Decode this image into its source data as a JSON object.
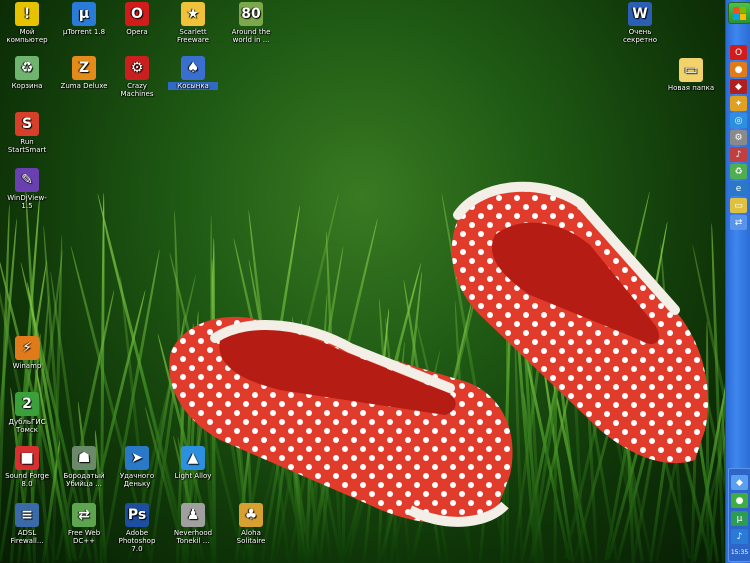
{
  "desktop": {
    "icons": [
      {
        "label": "Мой компьютер",
        "icon": "my-computer-warning-icon"
      },
      {
        "label": "µTorrent 1.8",
        "icon": "utorrent-icon"
      },
      {
        "label": "Opera",
        "icon": "opera-icon"
      },
      {
        "label": "Scarlett Freeware",
        "icon": "scarlett-icon"
      },
      {
        "label": "Around the world in ...",
        "icon": "around-world-game-icon"
      },
      {
        "label": "Очень секретно",
        "icon": "word-document-icon"
      },
      {
        "label": "Корзина",
        "icon": "recycle-bin-icon"
      },
      {
        "label": "Zuma Deluxe",
        "icon": "zuma-deluxe-icon"
      },
      {
        "label": "Crazy Machines",
        "icon": "crazy-machines-icon"
      },
      {
        "label": "Косынка",
        "icon": "solitaire-shortcut-icon"
      },
      {
        "label": "Новая папка",
        "icon": "folder-icon"
      },
      {
        "label": "Run StartSmart",
        "icon": "startsmart-icon"
      },
      {
        "label": "WinDjView-1.5",
        "icon": "windjview-icon"
      },
      {
        "label": "Winamp",
        "icon": "winamp-icon"
      },
      {
        "label": "ДубльГИС Томск",
        "icon": "dublgis-icon"
      },
      {
        "label": "Sound Forge 8.0",
        "icon": "sound-forge-icon"
      },
      {
        "label": "Бородатый Убийца ...",
        "icon": "game-shortcut-icon"
      },
      {
        "label": "Удачного Деньку",
        "icon": "shortcut-icon"
      },
      {
        "label": "Light Alloy",
        "icon": "light-alloy-icon"
      },
      {
        "label": "ADSL Firewall...",
        "icon": "adsl-icon"
      },
      {
        "label": "Free Web DC++",
        "icon": "dcpp-icon"
      },
      {
        "label": "Adobe Photoshop 7.0",
        "icon": "photoshop-icon"
      },
      {
        "label": "Neverhood Tonekil ...",
        "icon": "game-icon"
      },
      {
        "label": "Aloha Solitaire",
        "icon": "aloha-solitaire-icon"
      }
    ]
  },
  "sidebar": {
    "buttons": [
      "start-icon",
      "opera-icon",
      "firefox-icon",
      "media-icon",
      "tool-icon",
      "globe-icon",
      "settings-icon",
      "music-icon",
      "recycle-icon",
      "ie-icon",
      "folder-icon",
      "network-icon"
    ],
    "clock": "15:35"
  }
}
